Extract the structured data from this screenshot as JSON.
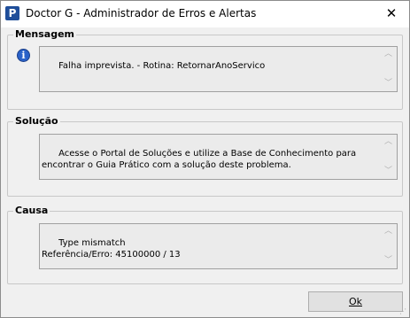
{
  "window": {
    "title": "Doctor G - Administrador de Erros e Alertas",
    "app_icon_letter": "P",
    "close_symbol": "✕"
  },
  "mensagem": {
    "label": "Mensagem",
    "icon": "info-icon",
    "text": "Falha imprevista. - Rotina: RetornarAnoServico"
  },
  "solucao": {
    "label": "Solução",
    "text": "Acesse o Portal de Soluções e utilize a Base de Conhecimento para encontrar o Guia Prático com a solução deste problema."
  },
  "causa": {
    "label": "Causa",
    "text": "Type mismatch\nReferência/Erro: 45100000 / 13"
  },
  "buttons": {
    "ok_label": "Ok"
  },
  "colors": {
    "accent": "#1f4e9a",
    "info": "#2a62c9"
  }
}
